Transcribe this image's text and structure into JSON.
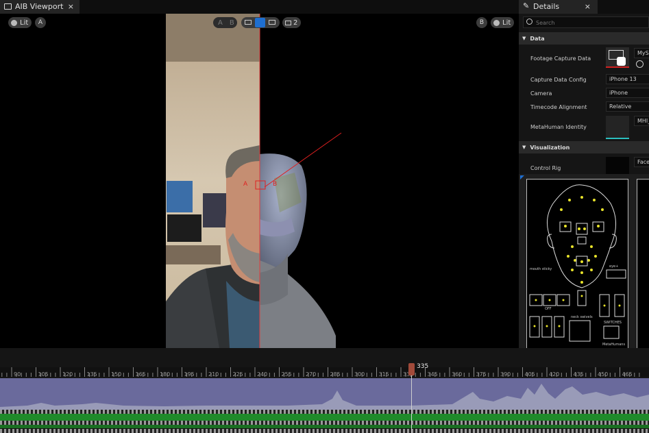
{
  "tabs": {
    "viewport_title": "AIB Viewport",
    "details_title": "Details",
    "close": "×"
  },
  "viewport": {
    "lit_left": "Lit",
    "a_badge": "A",
    "lit_right": "Lit",
    "b_badge": "B",
    "ab_a": "A",
    "ab_b": "B",
    "camera_count": "2",
    "overlay_a": "A",
    "overlay_b": "B"
  },
  "details": {
    "search_placeholder": "Search",
    "section_data": "Data",
    "section_visualization": "Visualization",
    "rows": [
      {
        "label": "Footage Capture Data",
        "value": "MyS"
      },
      {
        "label": "Capture Data Config",
        "value": "iPhone 13"
      },
      {
        "label": "Camera",
        "value": "iPhone"
      },
      {
        "label": "Timecode Alignment",
        "value": "Relative"
      },
      {
        "label": "MetaHuman Identity",
        "value": "MHI_"
      },
      {
        "label": "Control Rig",
        "value": "Face"
      }
    ],
    "rig_labels": {
      "mouth_sticky": "mouth sticky",
      "off": "OFF",
      "neck": "neck swivels",
      "switches": "SWITCHES",
      "eye": "eye+",
      "metahumans": "MetaHumans"
    }
  },
  "timeline": {
    "current_frame": "335",
    "ticks": [
      "90",
      "105",
      "120",
      "135",
      "150",
      "165",
      "180",
      "195",
      "210",
      "225",
      "240",
      "255",
      "270",
      "285",
      "300",
      "315",
      "330",
      "345",
      "360",
      "375",
      "390",
      "405",
      "420",
      "435",
      "450",
      "465"
    ]
  },
  "colors": {
    "accent_blue": "#1f6fd1",
    "playhead": "#a14a3a",
    "curve_bg": "#6a6a9c",
    "green_track": "#1f8a2a",
    "rig_yellow": "#e8e32a",
    "selection_red": "#e02020",
    "identity_teal": "#2bc0c0"
  },
  "icons": [
    "viewport-icon",
    "close-icon",
    "details-pencil-icon",
    "search-icon",
    "collapse-arrow-icon",
    "lit-sphere-icon",
    "single-view-icon",
    "wipe-view-icon",
    "split-view-icon",
    "camera-icon",
    "film-icon",
    "refresh-icon"
  ]
}
